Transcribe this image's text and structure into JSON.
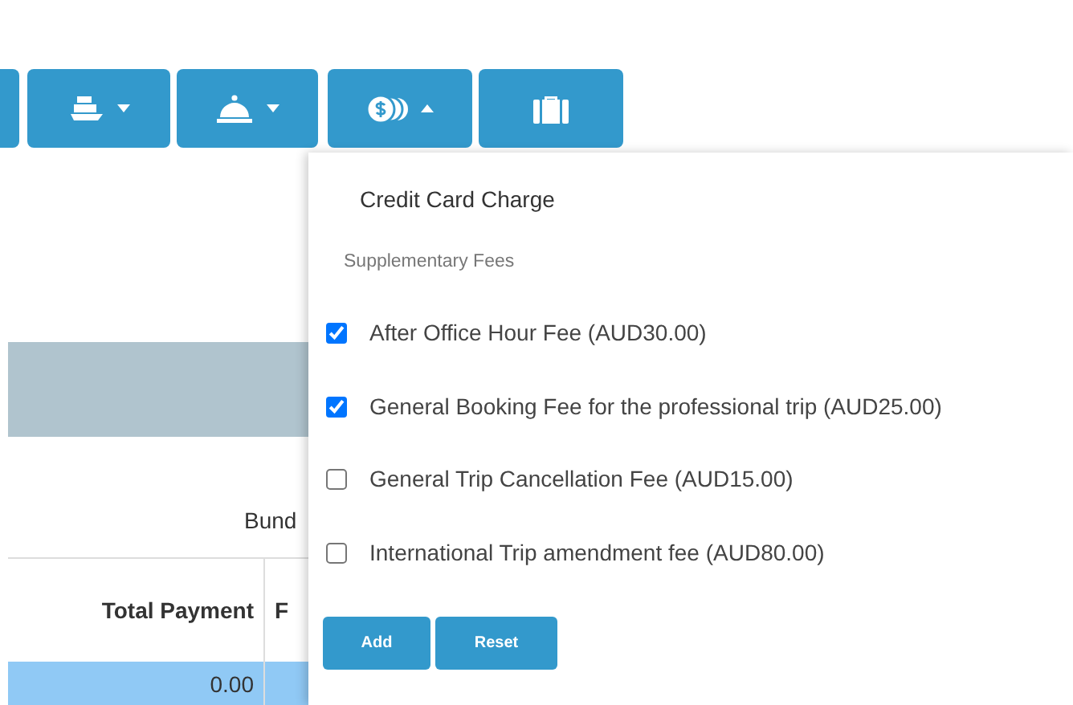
{
  "toolbar": [
    {
      "kind": "partial"
    },
    {
      "kind": "ship",
      "expanded": false
    },
    {
      "kind": "bell",
      "expanded": false
    },
    {
      "kind": "coins",
      "expanded": true
    },
    {
      "kind": "suitcase"
    }
  ],
  "background": {
    "label": "Bund",
    "table": {
      "columns": [
        "Total Payment",
        "F"
      ],
      "rows": [
        {
          "cells": [
            "0.00"
          ],
          "selected": true
        }
      ]
    }
  },
  "dropdown": {
    "title": "Credit Card Charge",
    "section": "Supplementary Fees",
    "fees": [
      {
        "label": "After Office Hour Fee (AUD30.00)",
        "checked": true
      },
      {
        "label": "General Booking Fee for the professional trip (AUD25.00)",
        "checked": true
      },
      {
        "label": "General Trip Cancellation Fee (AUD15.00)",
        "checked": false
      },
      {
        "label": "International Trip amendment fee (AUD80.00)",
        "checked": false
      }
    ],
    "buttons": [
      "Add",
      "Reset"
    ]
  }
}
